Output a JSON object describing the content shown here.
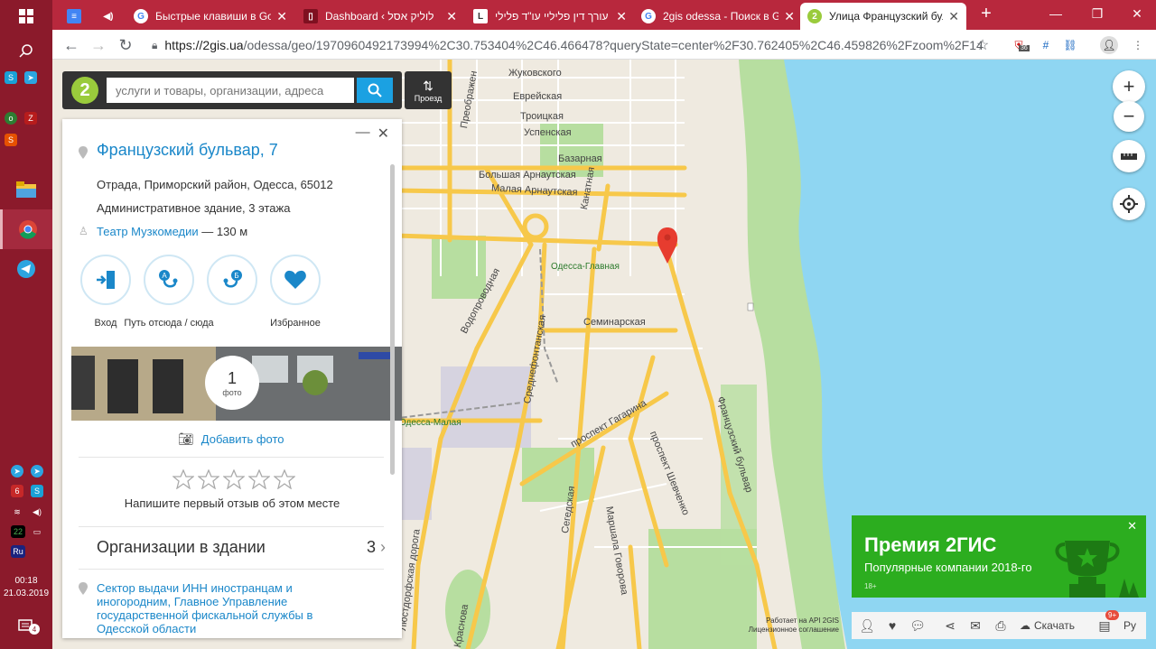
{
  "taskbar": {
    "clock_time": "00:18",
    "clock_date": "21.03.2019",
    "tray_number": "22",
    "lang": "Ru",
    "notif_count": "4"
  },
  "tabs": [
    {
      "title": "",
      "favicon": "docs-icon"
    },
    {
      "title": "",
      "favicon": "audio-icon"
    },
    {
      "title": "Быстрые клавиши в Goo",
      "favicon": "google-icon"
    },
    {
      "title": "Dashboard ‹ לוליק אסל",
      "favicon": "page-icon"
    },
    {
      "title": "עורך דין פליליי עו\"ד פלילי",
      "favicon": "l-icon"
    },
    {
      "title": "2gis odessa - Поиск в Go",
      "favicon": "google-icon"
    },
    {
      "title": "Улица Французский бульв",
      "favicon": "2gis-icon"
    }
  ],
  "toolbar": {
    "url_host": "https://2gis.ua",
    "url_path": "/odessa/geo/1970960492173994%2C30.753404%2C46.466478?queryState=center%2F30.762405%2C46.459826%2Fzoom%2F14",
    "ext_badge": "36"
  },
  "search": {
    "placeholder": "услуги и товары, организации, адреса",
    "route_label": "Проезд"
  },
  "card": {
    "title": "Французский бульвар, 7",
    "address": "Отрада, Приморский район, Одесса, 65012",
    "building": "Административное здание, 3 этажа",
    "nearby_link": "Театр Музкомедии",
    "nearby_dist": " — 130 м",
    "actions": [
      "Вход",
      "Путь отсюда / сюда",
      "Избранное"
    ],
    "photo_count": "1",
    "photo_label": "фото",
    "add_photo": "Добавить фото",
    "review_prompt": "Напишите первый отзыв об этом месте",
    "orgs_label": "Организации в здании",
    "orgs_count": "3",
    "org_item": "Сектор выдачи ИНН иностранцам и иногородним, Главное Управление государственной фискальной службы в Одесской области"
  },
  "map_labels": {
    "zhukovsky": "Жуковского",
    "evreyskaya": "Еврейская",
    "troitskaya": "Троицкая",
    "uspenskaya": "Успенская",
    "bazarnaya": "Базарная",
    "bolshaya_arn": "Большая Арнаутская",
    "malaya_arn": "Малая Арнаутская",
    "kanatnaya": "Канатная",
    "odessa_glavnaya": "Одесса-Главная",
    "vodoprovodnaya": "Водопроводная",
    "seminarskaya": "Семинарская",
    "srednefontanskaya": "Среднефонтанская",
    "odessa_malaya": "Одесса-Малая",
    "gagarina": "проспект Гагарина",
    "shevchenko": "проспект Шевченко",
    "frantsuzsky": "Французский бульвар",
    "lustdorfskaya": "Люстдорфская дорога",
    "segedskaya": "Сегедская",
    "govorova": "Маршала Говорова",
    "krasnova": "Краснова",
    "preobrazhen": "Преображен"
  },
  "promo": {
    "title": "Премия 2ГИС",
    "subtitle": "Популярные компании 2018-го",
    "age": "18+"
  },
  "bottom": {
    "download": "Скачать",
    "lang": "Ру",
    "badge": "9+",
    "attribution_1": "Работает на API 2GIS",
    "attribution_2": "Лицензионное соглашение"
  },
  "colors": {
    "taskbar": "#8b1a2b",
    "tabbar": "#b8283d",
    "sea": "#8fd6f2",
    "park": "#b7dea0",
    "road_major": "#f7c84a",
    "accent": "#1a87c9",
    "promo": "#2cad1f",
    "pin": "#e73c2f"
  }
}
